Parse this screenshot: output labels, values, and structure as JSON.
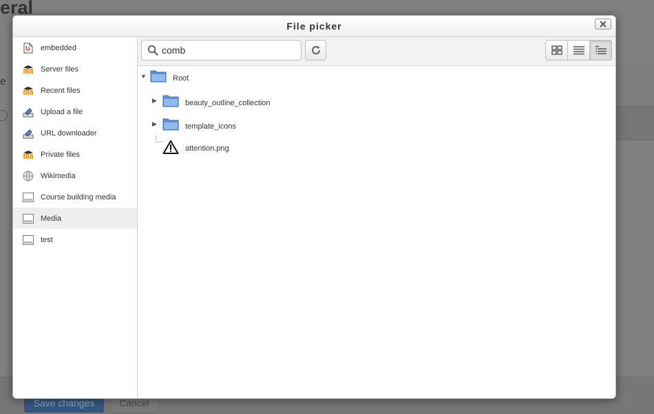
{
  "background": {
    "heading_fragment": "eral",
    "side_letter": "e",
    "save_label": "Save changes",
    "cancel_label": "Cancel"
  },
  "dialog": {
    "title": "File picker",
    "close_icon": "close-icon"
  },
  "sidebar": {
    "items": [
      {
        "label": "embedded",
        "icon": "document-icon"
      },
      {
        "label": "Server files",
        "icon": "moodle-icon"
      },
      {
        "label": "Recent files",
        "icon": "moodle-icon"
      },
      {
        "label": "Upload a file",
        "icon": "upload-icon"
      },
      {
        "label": "URL downloader",
        "icon": "upload-icon"
      },
      {
        "label": "Private files",
        "icon": "moodle-icon"
      },
      {
        "label": "Wikimedia",
        "icon": "globe-icon"
      },
      {
        "label": "Course building media",
        "icon": "repository-icon"
      },
      {
        "label": "Media",
        "icon": "repository-icon",
        "active": true
      },
      {
        "label": "test",
        "icon": "repository-icon"
      }
    ]
  },
  "toolbar": {
    "search_value": "comb",
    "search_icon": "search-icon",
    "refresh_icon": "refresh-icon",
    "views": [
      "icons-view",
      "list-view",
      "tree-view"
    ],
    "active_view": "tree-view"
  },
  "tree": {
    "root_label": "Root",
    "items": [
      {
        "label": "beauty_outline_collection",
        "type": "folder"
      },
      {
        "label": "template_icons",
        "type": "folder"
      },
      {
        "label": "attention.png",
        "type": "file"
      }
    ]
  },
  "colors": {
    "accent": "#35577f",
    "folder": "#6fa0dc",
    "overlay": "#808080"
  }
}
